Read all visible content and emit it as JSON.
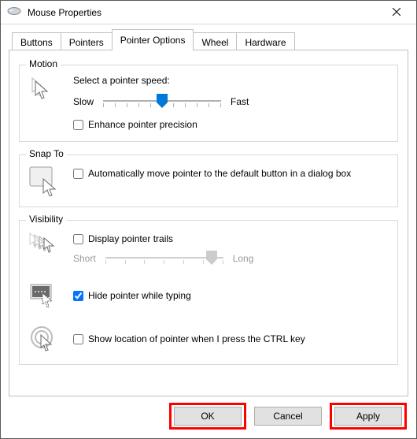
{
  "window": {
    "title": "Mouse Properties"
  },
  "tabs": {
    "buttons": "Buttons",
    "pointers": "Pointers",
    "pointer_options": "Pointer Options",
    "wheel": "Wheel",
    "hardware": "Hardware"
  },
  "motion": {
    "title": "Motion",
    "select_speed": "Select a pointer speed:",
    "slow": "Slow",
    "fast": "Fast",
    "speed_position_pct": 50,
    "enhance": "Enhance pointer precision",
    "enhance_checked": false
  },
  "snap_to": {
    "title": "Snap To",
    "auto_move": "Automatically move pointer to the default button in a dialog box",
    "auto_move_checked": false
  },
  "visibility": {
    "title": "Visibility",
    "trails": "Display pointer trails",
    "trails_checked": false,
    "short": "Short",
    "long": "Long",
    "trail_position_pct": 90,
    "hide_typing": "Hide pointer while typing",
    "hide_typing_checked": true,
    "show_ctrl": "Show location of pointer when I press the CTRL key",
    "show_ctrl_checked": false
  },
  "buttons": {
    "ok": "OK",
    "cancel": "Cancel",
    "apply": "Apply"
  }
}
